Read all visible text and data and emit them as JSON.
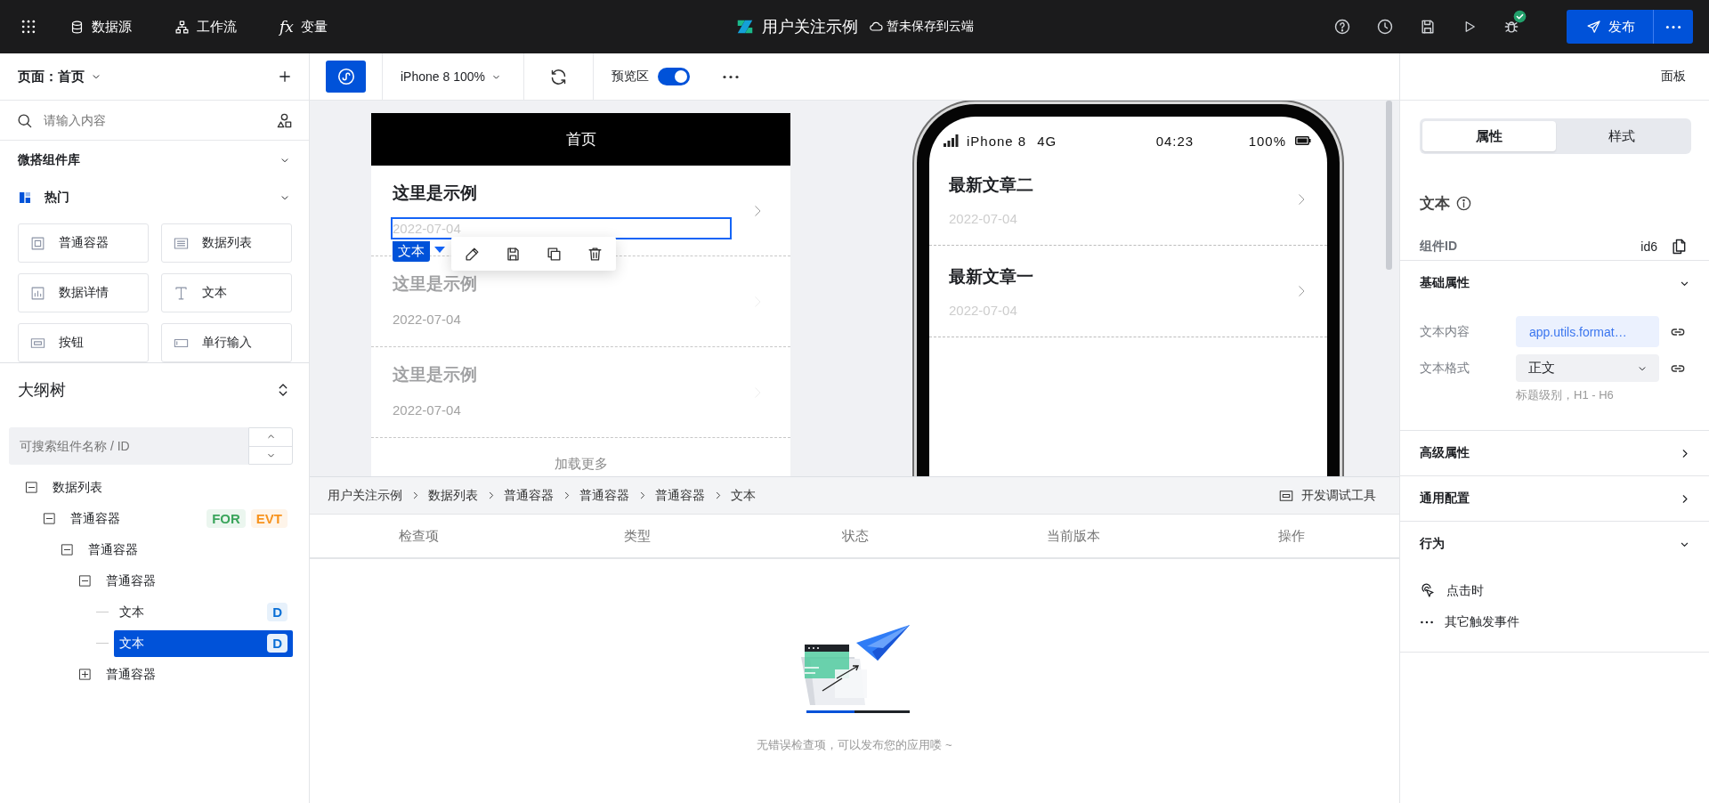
{
  "topbar": {
    "nav": [
      {
        "kind": "datasource",
        "label": "数据源"
      },
      {
        "kind": "workflow",
        "label": "工作流"
      },
      {
        "kind": "variable",
        "glyph": "fx",
        "label": "变量"
      }
    ],
    "app_title": "用户关注示例",
    "save_status": "暂未保存到云端",
    "publish_button": "发布"
  },
  "page_selector": "页面：首页",
  "component_search": {
    "placeholder": "请输入内容"
  },
  "library": {
    "title": "微搭组件库",
    "category": {
      "label": "热门",
      "expanded": true
    },
    "components": [
      {
        "kind": "container",
        "label": "普通容器"
      },
      {
        "kind": "list",
        "label": "数据列表"
      },
      {
        "kind": "detail",
        "label": "数据详情"
      },
      {
        "kind": "text",
        "label": "文本"
      },
      {
        "kind": "button",
        "label": "按钮"
      },
      {
        "kind": "input",
        "label": "单行输入"
      }
    ]
  },
  "outline": {
    "title": "大纲树",
    "search": {
      "placeholder": "可搜索组件名称 / ID"
    },
    "tree": [
      {
        "label": "数据列表",
        "expanded": true,
        "selected": false,
        "children": [
          {
            "label": "普通容器",
            "expanded": true,
            "selected": false,
            "badges": [
              {
                "text": "FOR",
                "color": "#3ba55c"
              },
              {
                "text": "EVT",
                "color": "#f7931e"
              }
            ],
            "children": [
              {
                "label": "普通容器",
                "expanded": true,
                "selected": false,
                "children": [
                  {
                    "label": "普通容器",
                    "expanded": true,
                    "selected": false,
                    "children": [
                      {
                        "label": "文本",
                        "selected": false,
                        "badges": [
                          {
                            "text": "D",
                            "color": "#0a6fd6"
                          }
                        ]
                      },
                      {
                        "label": "文本",
                        "selected": true,
                        "badges": [
                          {
                            "text": "D",
                            "color": "#0a6fd6"
                          }
                        ]
                      }
                    ]
                  },
                  {
                    "label": "普通容器",
                    "expanded": false,
                    "selected": false
                  }
                ]
              }
            ]
          }
        ]
      }
    ]
  },
  "toolbar": {
    "device": "iPhone 8 100%",
    "preview": {
      "label": "预览区",
      "on": true
    }
  },
  "editor_page": {
    "title": "首页",
    "rows": [
      {
        "title": "这里是示例",
        "date": "2022-07-04",
        "selected": true,
        "placeholder": false
      },
      {
        "title": "这里是示例",
        "date": "2022-07-04",
        "selected": false,
        "placeholder": true
      },
      {
        "title": "这里是示例",
        "date": "2022-07-04",
        "selected": false,
        "placeholder": true
      }
    ],
    "selection_tag": "文本",
    "load_more": "加载更多"
  },
  "preview_phone": {
    "carrier": "iPhone 8",
    "network": "4G",
    "time": "04:23",
    "battery": "100%",
    "articles": [
      {
        "title": "最新文章二",
        "date": "2022-07-04"
      },
      {
        "title": "最新文章一",
        "date": "2022-07-04"
      }
    ]
  },
  "breadcrumb": [
    "用户关注示例",
    "数据列表",
    "普通容器",
    "普通容器",
    "普通容器",
    "文本"
  ],
  "dev_tools_button": "开发调试工具",
  "checks": {
    "columns": [
      "检查项",
      "类型",
      "状态",
      "当前版本",
      "操作"
    ],
    "empty_message": "无错误检查项，可以发布您的应用喽 ~"
  },
  "right_panel": {
    "panel_button": "面板",
    "tabs": [
      {
        "label": "属性",
        "selected": true
      },
      {
        "label": "样式",
        "selected": false
      }
    ],
    "component": {
      "title": "文本",
      "id_label": "组件ID",
      "id": "id6"
    },
    "sections": [
      {
        "kind": "basic",
        "title": "基础属性",
        "expanded": true,
        "fields": [
          {
            "kind": "binding",
            "label": "文本内容",
            "value": "app.utils.format…"
          },
          {
            "kind": "select",
            "label": "文本格式",
            "value": "正文",
            "hint": "标题级别，H1 - H6"
          }
        ]
      },
      {
        "title": "高级属性",
        "expanded": false
      },
      {
        "title": "通用配置",
        "expanded": false
      },
      {
        "kind": "behavior",
        "title": "行为",
        "expanded": true,
        "events": [
          {
            "kind": "click",
            "label": "点击时"
          },
          {
            "kind": "more",
            "label": "其它触发事件"
          }
        ]
      }
    ]
  }
}
